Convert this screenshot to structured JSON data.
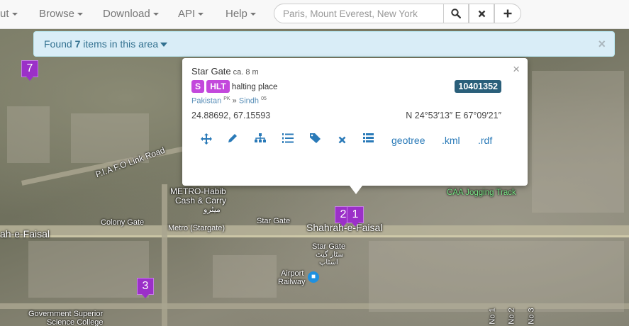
{
  "navbar": {
    "items": [
      {
        "label": "ut",
        "name": "nav-about"
      },
      {
        "label": "Browse",
        "name": "nav-browse"
      },
      {
        "label": "Download",
        "name": "nav-download"
      },
      {
        "label": "API",
        "name": "nav-api"
      },
      {
        "label": "Help",
        "name": "nav-help"
      }
    ],
    "search_placeholder": "Paris, Mount Everest, New York",
    "search_value": ""
  },
  "alert": {
    "prefix": "Found ",
    "count": "7",
    "suffix": " items in this area",
    "close": "×"
  },
  "popup": {
    "name": "Star Gate",
    "elevation": "ca. 8 m",
    "class_code": "S",
    "feature_code": "HLT",
    "feature_desc": "halting place",
    "geonameid": "10401352",
    "country": "Pakistan",
    "country_code": "PK",
    "separator": "»",
    "admin1": "Sindh",
    "admin1_code": "05",
    "decimal_coords": "24.88692, 67.15593",
    "dms_coords": "N 24°53′13″ E 67°09′21″",
    "close": "×",
    "links": {
      "geotree": "geotree",
      "kml": ".kml",
      "rdf": ".rdf"
    },
    "tool_icons": [
      "move-icon",
      "pencil-icon",
      "sitemap-icon",
      "list-ol-icon",
      "tags-icon",
      "delete-icon",
      "list-icon"
    ]
  },
  "markers": [
    "7",
    "3",
    "2",
    "1"
  ],
  "map_labels": {
    "pia": "P.I.A F.O Link Road",
    "metro_habib": "METRO-Habib",
    "cash_carry": "Cash & Carry",
    "urdu_metro": "میٹرو",
    "caa": "CAA Jogging Track",
    "shahrah_left": "ah-e-Faisal",
    "shahrah_main": "Shahrah-e-Faisal",
    "colony_gate": "Colony Gate",
    "metro_stargate": "Metro (Stargate)",
    "star_gate_road": "Star Gate",
    "star_gate": "Star Gate",
    "star_gate_urdu": "سٹار گیٹ",
    "star_gate_urdu2": "اسٹاپ",
    "airport_railway": "Airport",
    "railway": "Railway",
    "govt_college": "Government Superior",
    "science_college": "Science College",
    "no1": "No 1",
    "no2": "No 2",
    "no3": "No 3"
  },
  "colors": {
    "marker": "#9b30c8",
    "alert_bg": "#d9edf7",
    "link": "#2a7ab8",
    "geoid_badge": "#2a5f7a",
    "class_label": "#c348dc"
  }
}
